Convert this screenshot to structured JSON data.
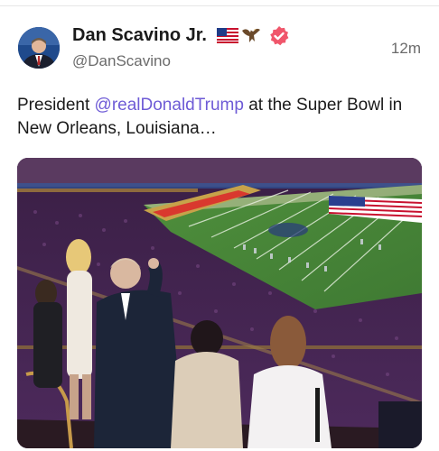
{
  "post": {
    "author_name": "Dan Scavino Jr.",
    "handle": "@DanScavino",
    "timestamp": "12m",
    "text_before": "President ",
    "mention": "@realDonaldTrump",
    "text_after": " at the Super Bowl in New Orleans, Louisiana…",
    "badges": [
      "us-flag-icon",
      "eagle-icon",
      "verified-badge-icon"
    ],
    "verified_color": "#f0566b",
    "mention_color": "#6e5bd6"
  }
}
